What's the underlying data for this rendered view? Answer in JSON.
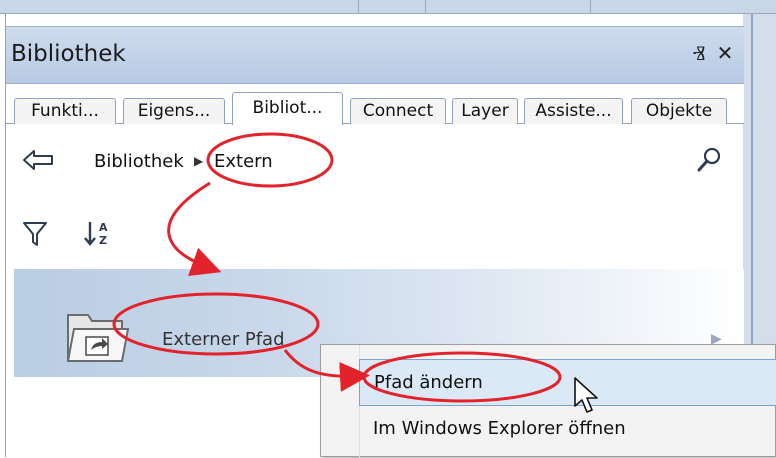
{
  "panel": {
    "title": "Bibliothek",
    "pin_icon": "pin-icon",
    "close_icon": "close-icon",
    "pin_glyph": "Ⱐ",
    "close_glyph": "✕"
  },
  "tabs": [
    {
      "label": "Funkti..."
    },
    {
      "label": "Eigens..."
    },
    {
      "label": "Bibliot..."
    },
    {
      "label": "Connect"
    },
    {
      "label": "Layer"
    },
    {
      "label": "Assiste..."
    },
    {
      "label": "Objekte"
    }
  ],
  "breadcrumb": {
    "back_icon": "back-arrow-icon",
    "root": "Bibliothek",
    "separator": "▶",
    "current": "Extern",
    "search_icon": "search-icon"
  },
  "toolbar": {
    "filter_icon": "filter-icon",
    "sort_icon": "sort-az-icon",
    "sort_glyph": "↓₆ᴢ"
  },
  "item": {
    "label": "Externer Pfad",
    "icon": "folder-link-icon",
    "arrow": "▶"
  },
  "context_menu": {
    "items": [
      {
        "label": "Pfad ändern"
      },
      {
        "label": "Im Windows Explorer öffnen"
      }
    ]
  },
  "colors": {
    "annotation": "#e3232b",
    "titlebar": "#c3d3ea",
    "hover": "#dbe9f7"
  }
}
